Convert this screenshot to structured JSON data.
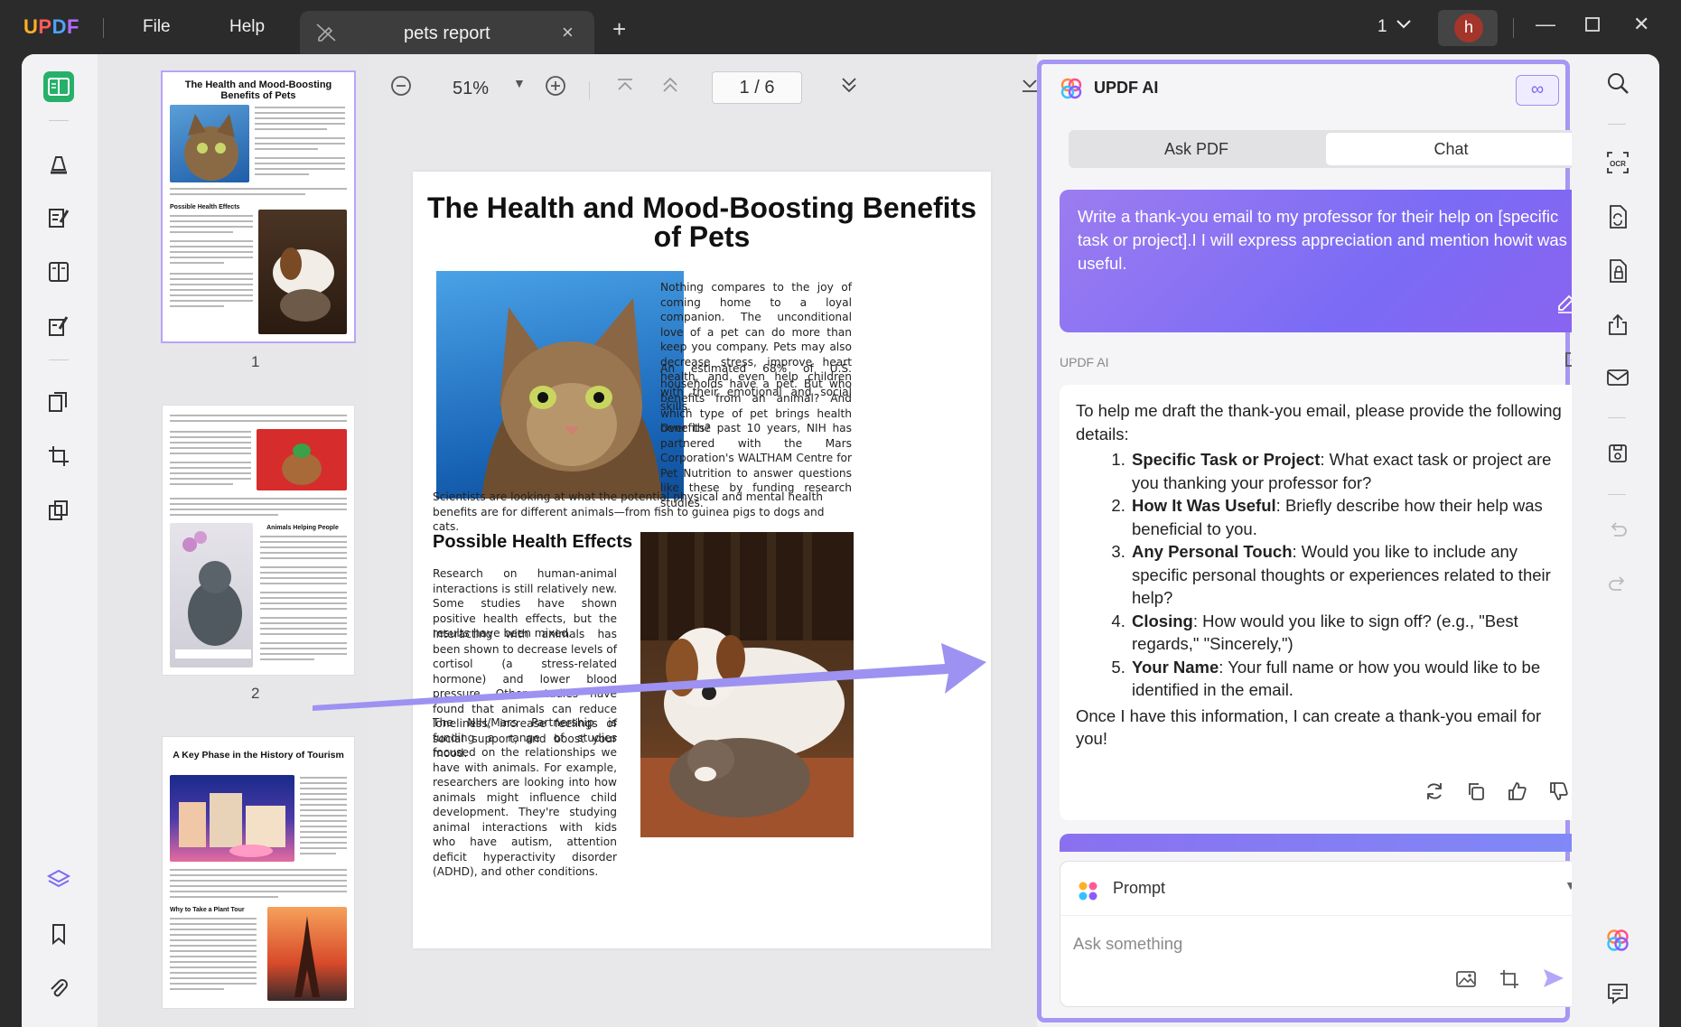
{
  "titlebar": {
    "logo": [
      "U",
      "P",
      "D",
      "F"
    ],
    "menu": [
      "File",
      "Help"
    ],
    "tab_title": "pets report",
    "page_indicator": "1",
    "avatar_letter": "h"
  },
  "viewer": {
    "zoom": "51%",
    "page_display": "1 / 6"
  },
  "thumbnails": [
    {
      "number": "1",
      "title": "The Health and Mood-Boosting Benefits of Pets"
    },
    {
      "number": "2",
      "title": ""
    },
    {
      "number": "",
      "title": "A Key Phase in the History of Tourism"
    }
  ],
  "document": {
    "title": "The Health and Mood-Boosting Benefits of Pets",
    "p1": "Nothing compares to the joy of coming home to a loyal companion. The unconditional love of a pet can do more than keep you company. Pets may also decrease stress, improve heart health, and even help children with their emotional and social skills.",
    "p2": "An estimated 68% of U.S. households have a pet. But who benefits from an animal? And which type of pet brings health benefits?",
    "p3": "Over the past 10 years, NIH has partnered with the Mars Corporation's WALTHAM Centre for Pet Nutrition to answer questions like these by funding research studies.",
    "p4": "Scientists are looking at what the potential physical and mental health benefits are for different animals—from fish to guinea pigs to dogs and cats.",
    "h2": "Possible Health Effects",
    "p5": "Research on human-animal interactions is still relatively new. Some studies have shown positive health effects, but the results have been mixed.",
    "p6": "Interacting with animals has been shown to decrease levels of cortisol (a stress-related hormone) and lower blood pressure. Other studies have found that animals can reduce loneliness, increase feelings of social support, and boost your mood.",
    "p7": "The NIH/Mars Partnership is funding a range of studies focused on the relationships we have with animals. For example, researchers are looking into how animals might influence child development. They're studying animal interactions with kids who have autism, attention deficit hyperactivity disorder (ADHD), and other conditions."
  },
  "ai": {
    "title": "UPDF AI",
    "tabs": [
      "Ask PDF",
      "Chat"
    ],
    "user_message": "Write a thank-you email to my professor for their help on [specific task or project].I I will express appreciation and mention howit was useful.",
    "responder_label": "UPDF AI",
    "intro": "To help me draft the thank-you email, please provide the following details:",
    "items": [
      {
        "label": "Specific Task or Project",
        "text": ": What exact task or project are you thanking your professor for?"
      },
      {
        "label": "How It Was Useful",
        "text": ": Briefly describe how their help was beneficial to you."
      },
      {
        "label": "Any Personal Touch",
        "text": ": Would you like to include any specific personal thoughts or experiences related to their help?"
      },
      {
        "label": "Closing",
        "text": ": How would you like to sign off? (e.g., \"Best regards,\" \"Sincerely,\")"
      },
      {
        "label": "Your Name",
        "text": ": Your full name or how you would like to be identified in the email."
      }
    ],
    "outro": "Once I have this information, I can create a thank-you email for you!",
    "prompt_label": "Prompt",
    "ask_placeholder": "Ask something"
  },
  "colors": {
    "accent": "#7b6bf5",
    "panel_border": "#a597f3",
    "active_tool": "#27b06a"
  },
  "icons": {
    "left_rail": [
      "reader-icon",
      "comment-icon",
      "edit-icon",
      "page-layout-icon",
      "fill-sign-icon",
      "organize-pages-icon",
      "crop-icon",
      "compare-icon",
      "layers-icon",
      "bookmark-icon",
      "attachment-icon"
    ],
    "right_rail": [
      "search-icon",
      "ocr-icon",
      "convert-icon",
      "protect-icon",
      "share-icon",
      "email-icon",
      "save-icon",
      "undo-icon",
      "redo-icon",
      "ai-assistant-icon",
      "comments-panel-icon"
    ]
  }
}
